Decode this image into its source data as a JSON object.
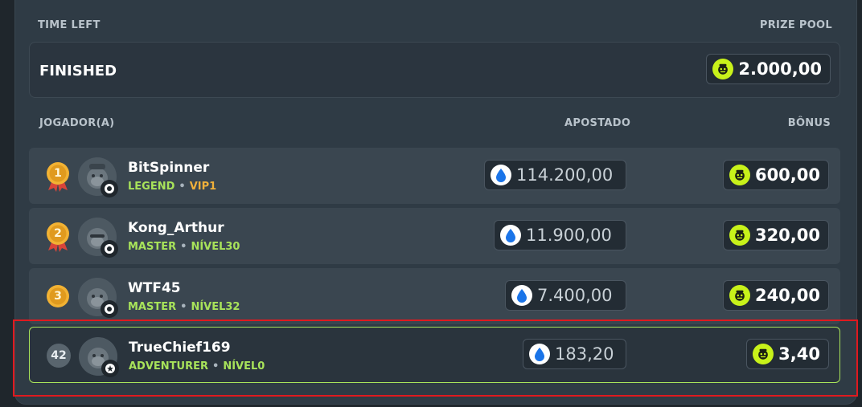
{
  "header": {
    "time_left_label": "TIME LEFT",
    "prize_pool_label": "PRIZE POOL",
    "status": "FINISHED",
    "prize_pool_amount": "2.000,00"
  },
  "columns": {
    "player": "JOGADOR(A)",
    "wagered": "APOSTADO",
    "bonus": "BÔNUS"
  },
  "rows": [
    {
      "rank": "1",
      "name": "BitSpinner",
      "tier": "LEGEND",
      "level": "VIP1",
      "level_is_vip": true,
      "wagered": "114.200,00",
      "bonus": "600,00"
    },
    {
      "rank": "2",
      "name": "Kong_Arthur",
      "tier": "MASTER",
      "level": "NÍVEL30",
      "level_is_vip": false,
      "wagered": "11.900,00",
      "bonus": "320,00"
    },
    {
      "rank": "3",
      "name": "WTF45",
      "tier": "MASTER",
      "level": "NÍVEL32",
      "level_is_vip": false,
      "wagered": "7.400,00",
      "bonus": "240,00"
    },
    {
      "rank": "42",
      "name": "TrueChief169",
      "tier": "ADVENTURER",
      "level": "NÍVEL0",
      "level_is_vip": false,
      "wagered": "183,20",
      "bonus": "3,40",
      "is_current_user": true
    }
  ],
  "colors": {
    "accent_green": "#a8e35a",
    "coin_lime": "#c8f21a",
    "vip_orange": "#f0b03a",
    "medal_gold": "#f2b233",
    "highlight_red": "#e0191f"
  },
  "icons": {
    "prize_coin": "kong-coin-icon",
    "wager_drop": "water-drop-icon",
    "medal": "medal-icon"
  }
}
